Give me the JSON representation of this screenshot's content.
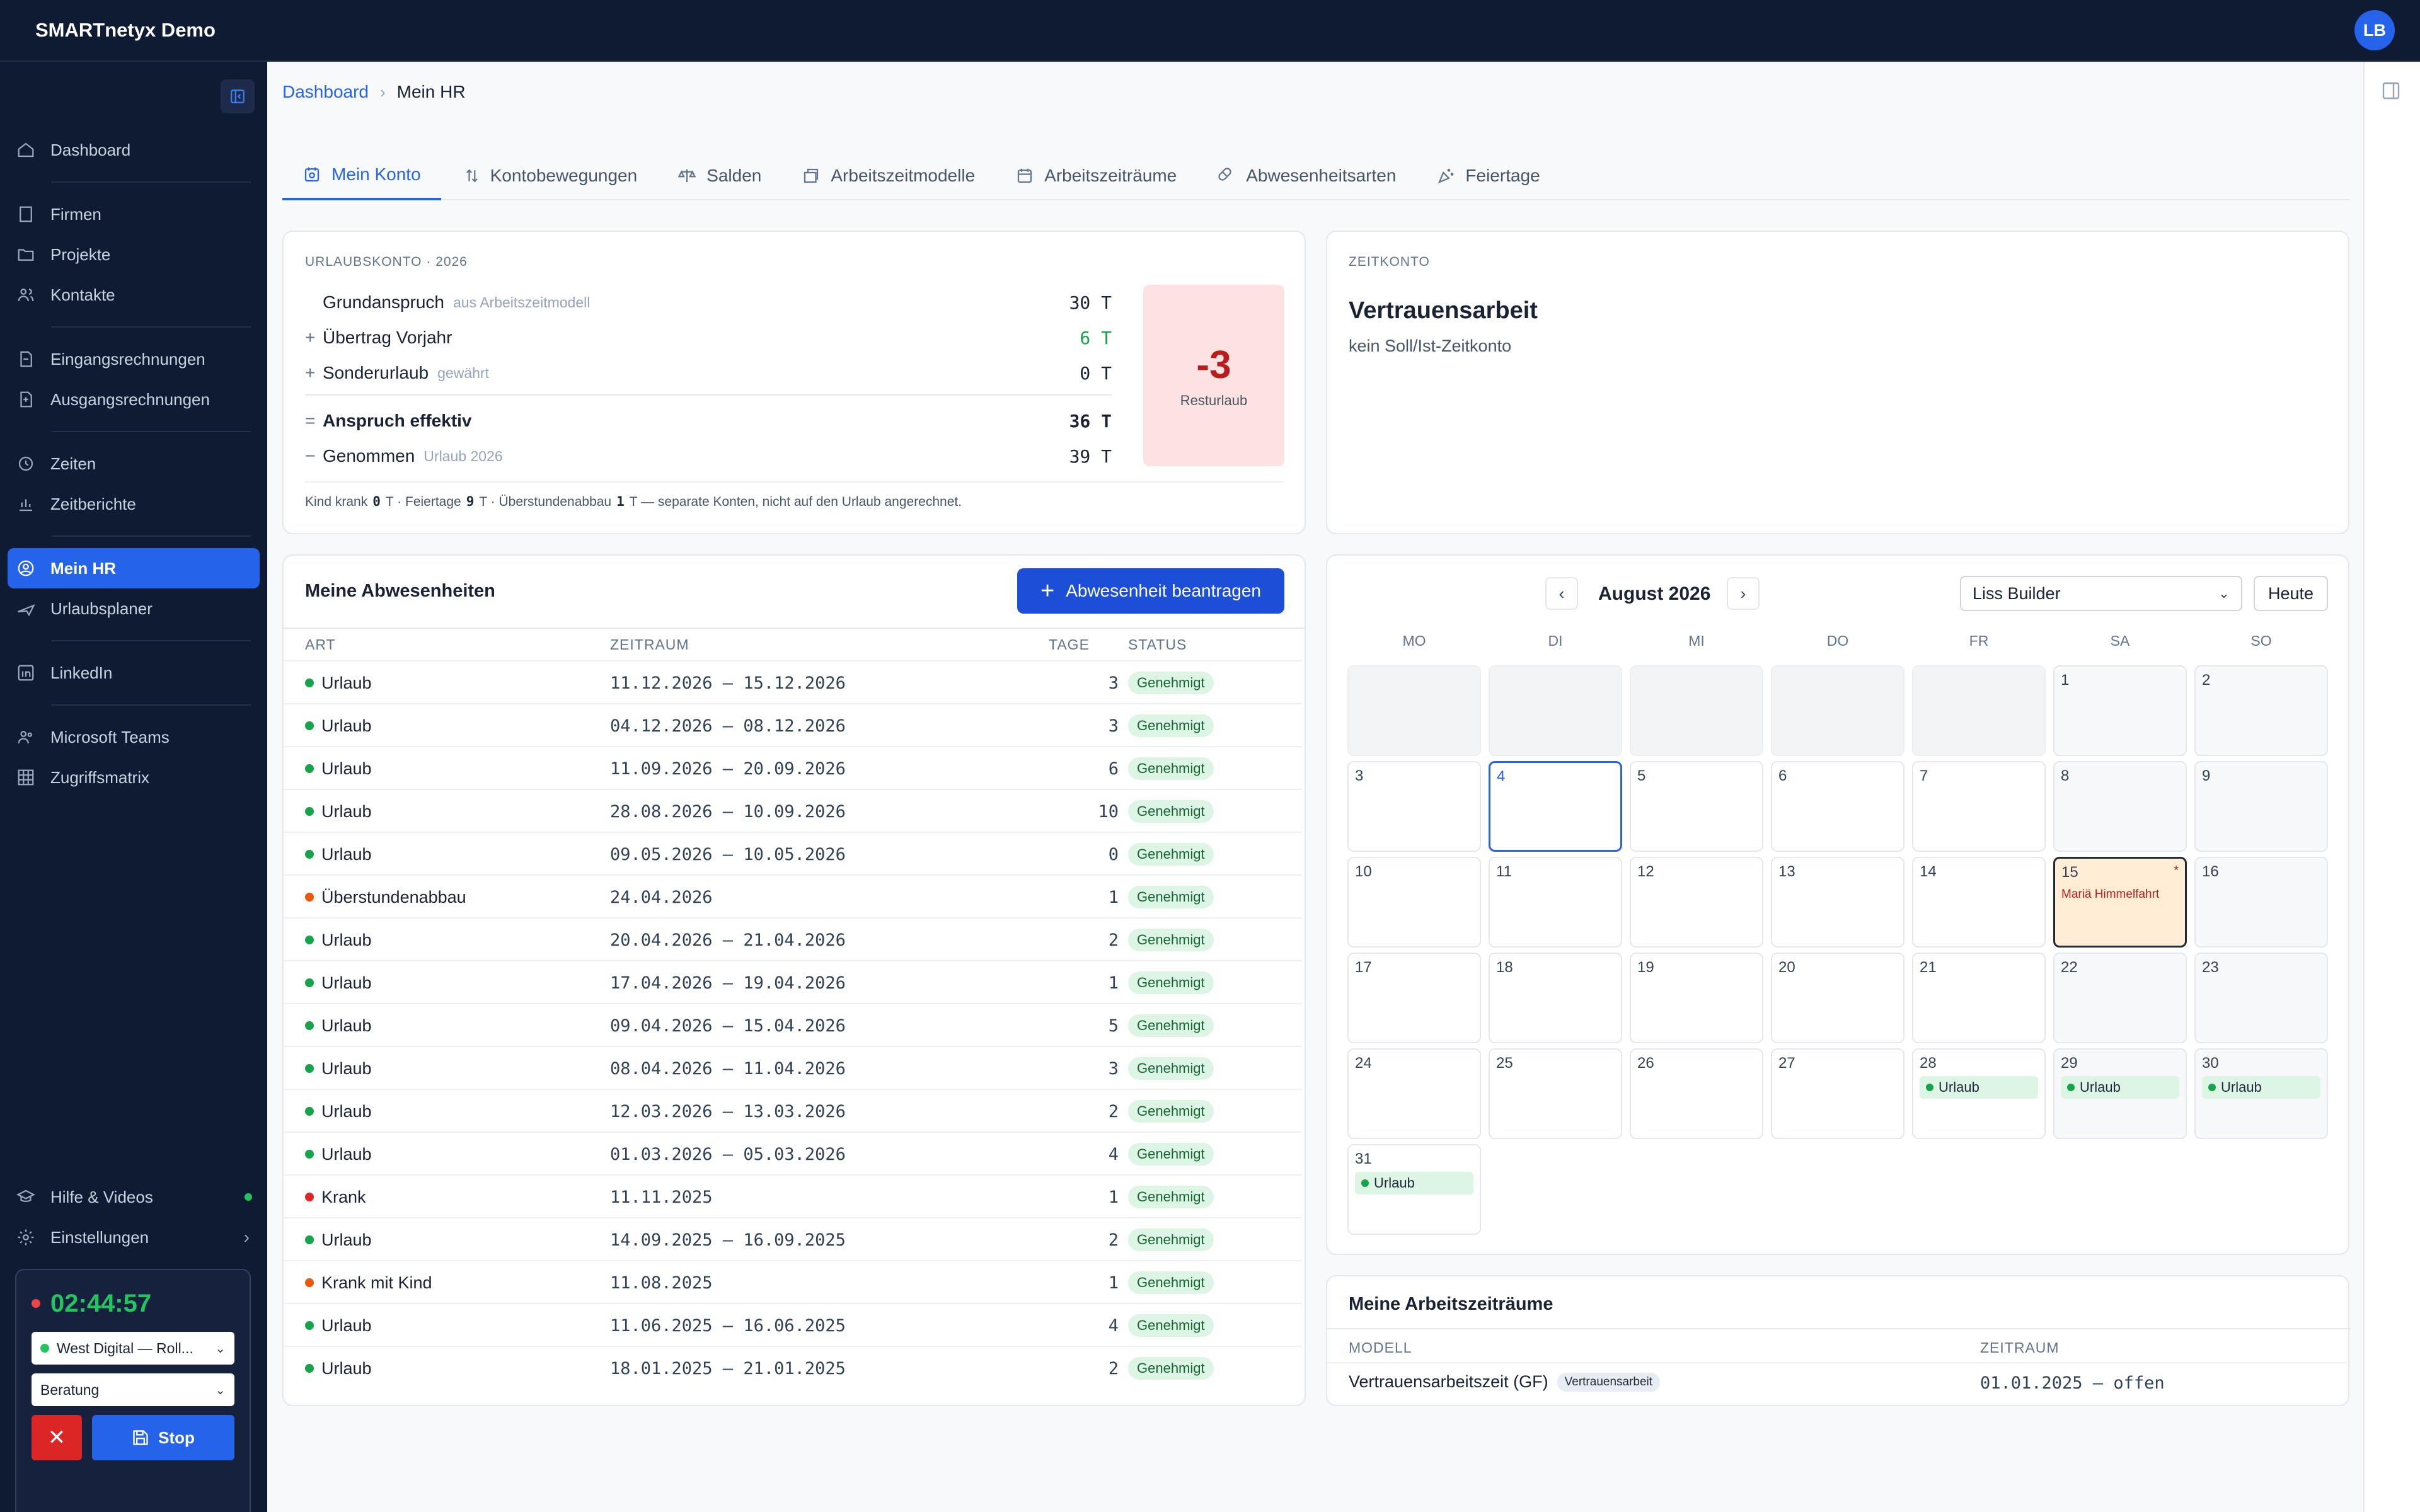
{
  "app": {
    "title": "SMARTnetyx Demo",
    "user_initials": "LB"
  },
  "sidebar": {
    "groups": [
      [
        {
          "label": "Dashboard",
          "icon": "home-icon"
        }
      ],
      [
        {
          "label": "Firmen",
          "icon": "building-icon"
        },
        {
          "label": "Projekte",
          "icon": "folder-icon"
        },
        {
          "label": "Kontakte",
          "icon": "users-icon"
        }
      ],
      [
        {
          "label": "Eingangsrechnungen",
          "icon": "invoice-in-icon"
        },
        {
          "label": "Ausgangsrechnungen",
          "icon": "invoice-out-icon"
        }
      ],
      [
        {
          "label": "Zeiten",
          "icon": "clock-icon"
        },
        {
          "label": "Zeitberichte",
          "icon": "chart-icon"
        }
      ],
      [
        {
          "label": "Mein HR",
          "icon": "user-circle-icon",
          "active": true
        },
        {
          "label": "Urlaubsplaner",
          "icon": "plane-icon"
        }
      ],
      [
        {
          "label": "LinkedIn",
          "icon": "linkedin-icon"
        }
      ],
      [
        {
          "label": "Microsoft Teams",
          "icon": "teams-icon"
        },
        {
          "label": "Zugriffsmatrix",
          "icon": "grid-icon"
        }
      ]
    ],
    "bottom": {
      "help": "Hilfe & Videos",
      "settings": "Einstellungen"
    },
    "timer": {
      "time": "02:44:57",
      "project": "West Digital — Roll...",
      "activity": "Beratung",
      "stop": "Stop"
    }
  },
  "breadcrumb": {
    "root": "Dashboard",
    "current": "Mein HR"
  },
  "tabs": [
    "Mein Konto",
    "Kontobewegungen",
    "Salden",
    "Arbeitszeitmodelle",
    "Arbeitszeiträume",
    "Abwesenheitsarten",
    "Feiertage"
  ],
  "urlaubskonto": {
    "label": "URLAUBSKONTO · 2026",
    "rows": [
      {
        "op": "",
        "label": "Grundanspruch",
        "sub": "aus Arbeitszeitmodell",
        "val": "30",
        "unit": "T"
      },
      {
        "op": "+",
        "label": "Übertrag Vorjahr",
        "sub": "",
        "val": "6",
        "unit": "T"
      },
      {
        "op": "+",
        "label": "Sonderurlaub",
        "sub": "gewährt",
        "val": "0",
        "unit": "T"
      },
      {
        "op": "=",
        "label": "Anspruch effektiv",
        "sub": "",
        "val": "36",
        "unit": "T"
      },
      {
        "op": "−",
        "label": "Genommen",
        "sub": "Urlaub 2026",
        "val": "39",
        "unit": "T"
      }
    ],
    "rest_value": "-3",
    "rest_label": "Resturlaub",
    "footnote_parts": [
      "Kind krank",
      "0",
      "T · Feiertage",
      "9",
      "T · Überstundenabbau",
      "1",
      "T — separate Konten, nicht auf den Urlaub angerechnet."
    ]
  },
  "zeitkonto": {
    "label": "ZEITKONTO",
    "title": "Vertrauensarbeit",
    "subtitle": "kein Soll/Ist-Zeitkonto"
  },
  "abwesenheiten": {
    "title": "Meine Abwesenheiten",
    "button": "Abwesenheit beantragen",
    "headers": [
      "ART",
      "ZEITRAUM",
      "TAGE",
      "STATUS"
    ],
    "rows": [
      {
        "art": "Urlaub",
        "zeitraum": "11.12.2026 – 15.12.2026",
        "tage": "3",
        "status": "Genehmigt",
        "color": "#16a34a"
      },
      {
        "art": "Urlaub",
        "zeitraum": "04.12.2026 – 08.12.2026",
        "tage": "3",
        "status": "Genehmigt",
        "color": "#16a34a"
      },
      {
        "art": "Urlaub",
        "zeitraum": "11.09.2026 – 20.09.2026",
        "tage": "6",
        "status": "Genehmigt",
        "color": "#16a34a"
      },
      {
        "art": "Urlaub",
        "zeitraum": "28.08.2026 – 10.09.2026",
        "tage": "10",
        "status": "Genehmigt",
        "color": "#16a34a"
      },
      {
        "art": "Urlaub",
        "zeitraum": "09.05.2026 – 10.05.2026",
        "tage": "0",
        "status": "Genehmigt",
        "color": "#16a34a"
      },
      {
        "art": "Überstundenabbau",
        "zeitraum": "24.04.2026",
        "tage": "1",
        "status": "Genehmigt",
        "color": "#ea580c"
      },
      {
        "art": "Urlaub",
        "zeitraum": "20.04.2026 – 21.04.2026",
        "tage": "2",
        "status": "Genehmigt",
        "color": "#16a34a"
      },
      {
        "art": "Urlaub",
        "zeitraum": "17.04.2026 – 19.04.2026",
        "tage": "1",
        "status": "Genehmigt",
        "color": "#16a34a"
      },
      {
        "art": "Urlaub",
        "zeitraum": "09.04.2026 – 15.04.2026",
        "tage": "5",
        "status": "Genehmigt",
        "color": "#16a34a"
      },
      {
        "art": "Urlaub",
        "zeitraum": "08.04.2026 – 11.04.2026",
        "tage": "3",
        "status": "Genehmigt",
        "color": "#16a34a"
      },
      {
        "art": "Urlaub",
        "zeitraum": "12.03.2026 – 13.03.2026",
        "tage": "2",
        "status": "Genehmigt",
        "color": "#16a34a"
      },
      {
        "art": "Urlaub",
        "zeitraum": "01.03.2026 – 05.03.2026",
        "tage": "4",
        "status": "Genehmigt",
        "color": "#16a34a"
      },
      {
        "art": "Krank",
        "zeitraum": "11.11.2025",
        "tage": "1",
        "status": "Genehmigt",
        "color": "#dc2626"
      },
      {
        "art": "Urlaub",
        "zeitraum": "14.09.2025 – 16.09.2025",
        "tage": "2",
        "status": "Genehmigt",
        "color": "#16a34a"
      },
      {
        "art": "Krank mit Kind",
        "zeitraum": "11.08.2025",
        "tage": "1",
        "status": "Genehmigt",
        "color": "#ea580c"
      },
      {
        "art": "Urlaub",
        "zeitraum": "11.06.2025 – 16.06.2025",
        "tage": "4",
        "status": "Genehmigt",
        "color": "#16a34a"
      },
      {
        "art": "Urlaub",
        "zeitraum": "18.01.2025 – 21.01.2025",
        "tage": "2",
        "status": "Genehmigt",
        "color": "#16a34a"
      }
    ]
  },
  "calendar": {
    "month": "August 2026",
    "person": "Liss Builder",
    "today_button": "Heute",
    "weekdays": [
      "MO",
      "DI",
      "MI",
      "DO",
      "FR",
      "SA",
      "SO"
    ],
    "days_in_month": 31,
    "first_weekday_index": 5,
    "today": 4,
    "holidays": [
      {
        "day": 15,
        "name": "Mariä Himmelfahrt"
      }
    ],
    "events": [
      {
        "day": 28,
        "label": "Urlaub"
      },
      {
        "day": 29,
        "label": "Urlaub"
      },
      {
        "day": 30,
        "label": "Urlaub"
      },
      {
        "day": 31,
        "label": "Urlaub"
      }
    ]
  },
  "arbeitszeitraeume": {
    "title": "Meine Arbeitszeiträume",
    "headers": [
      "MODELL",
      "ZEITRAUM"
    ],
    "rows": [
      {
        "modell": "Vertrauensarbeitszeit (GF)",
        "badge": "Vertrauensarbeit",
        "zeitraum": "01.01.2025 – offen"
      }
    ]
  }
}
